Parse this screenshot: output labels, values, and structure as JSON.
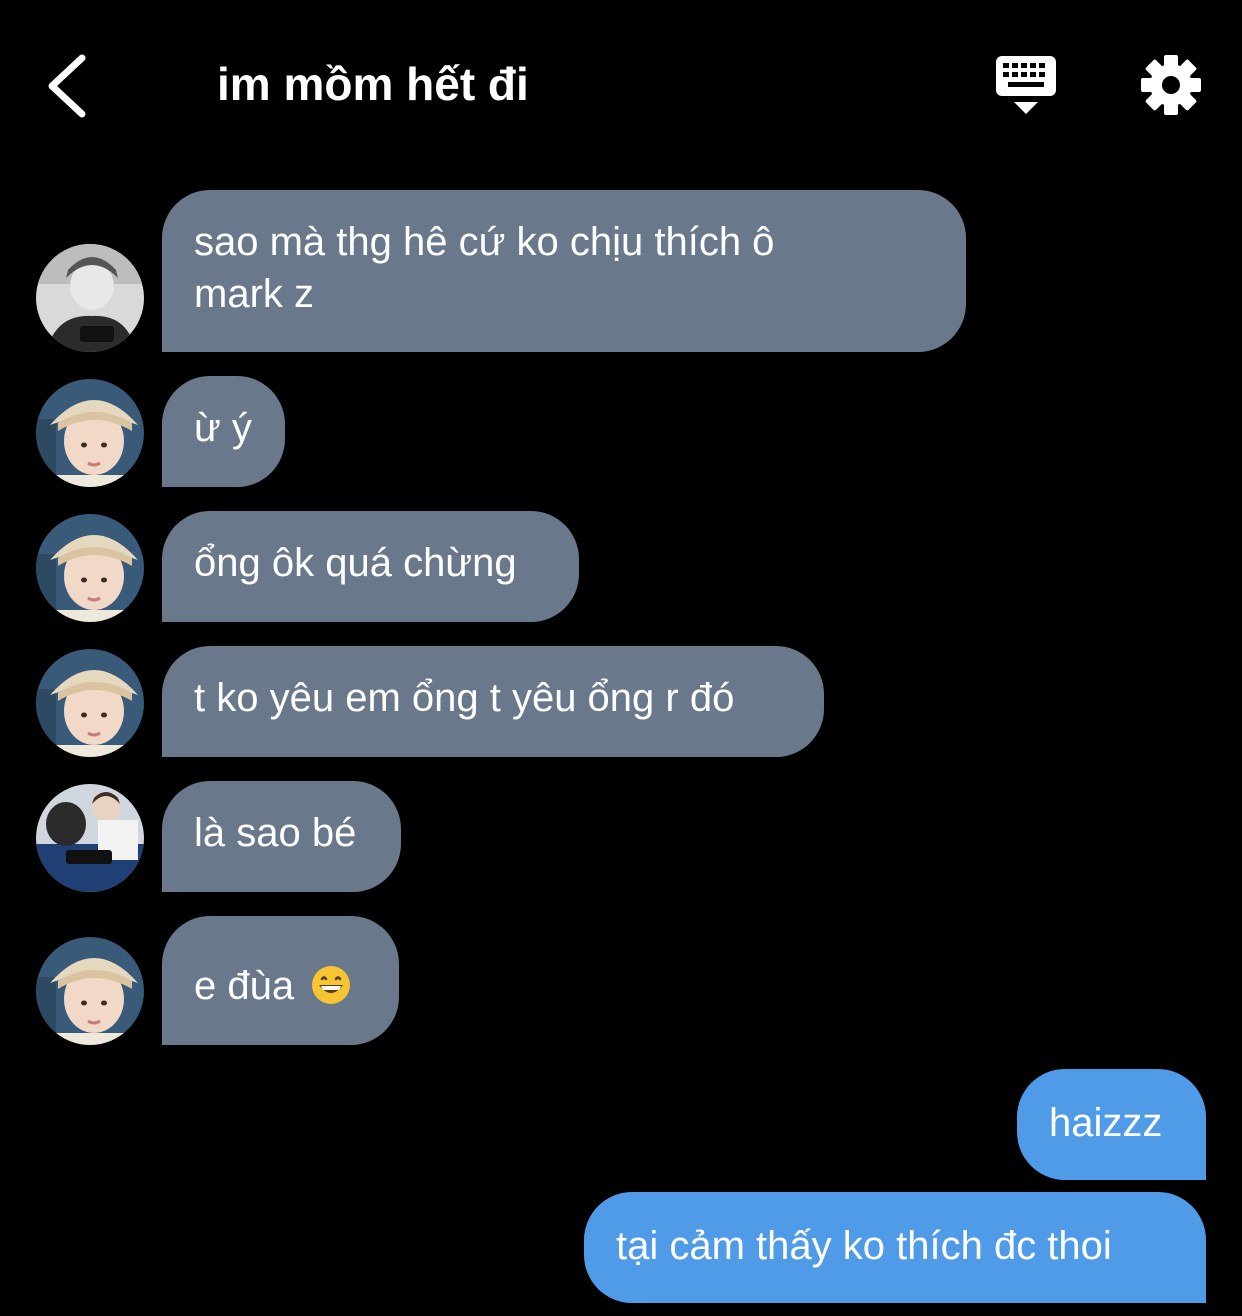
{
  "header": {
    "title": "im mồm hết đi",
    "back_icon": "chevron-left-icon",
    "keyboard_icon": "keyboard-icon",
    "settings_icon": "gear-icon"
  },
  "colors": {
    "background": "#000000",
    "incoming_bubble": "#69788a",
    "outgoing_bubble": "#4f9be8",
    "text": "#ffffff"
  },
  "messages": [
    {
      "direction": "incoming",
      "text_line1": "sao mà thg hê cứ ko chịu thích ô",
      "text_line2": "mark z",
      "avatar": "avatar-bw-boy"
    },
    {
      "direction": "incoming",
      "text": "ừ ý",
      "avatar": "avatar-hat-boy"
    },
    {
      "direction": "incoming",
      "text": "ổng ôk quá chừng",
      "avatar": "avatar-hat-boy"
    },
    {
      "direction": "incoming",
      "text": "t ko yêu em ổng t yêu ổng r đó",
      "avatar": "avatar-hat-boy"
    },
    {
      "direction": "incoming",
      "text": "là sao bé",
      "avatar": "avatar-blue-group"
    },
    {
      "direction": "incoming",
      "text": "e đùa",
      "emoji": "grinning-face-emoji",
      "avatar": "avatar-hat-boy"
    },
    {
      "direction": "outgoing",
      "text": "haizzz"
    },
    {
      "direction": "outgoing",
      "text": "tại cảm thấy ko thích đc thoi"
    }
  ]
}
